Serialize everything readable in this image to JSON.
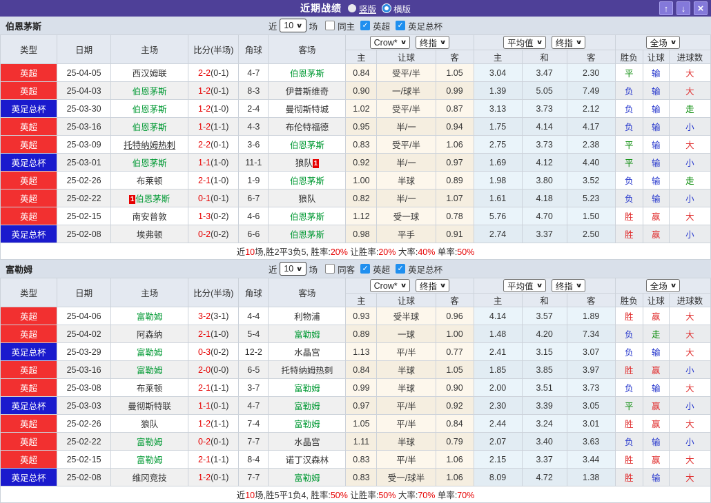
{
  "titlebar": {
    "title": "近期战绩",
    "radios": [
      {
        "label": "竖版",
        "selected": true
      },
      {
        "label": "横版",
        "selected": false
      }
    ],
    "up_icon": "↑",
    "down_icon": "↓",
    "close_icon": "×"
  },
  "colors": {
    "titlebar_purple": "#4e4098",
    "button_purple": "#8479da",
    "league_badge_red": "#f23030",
    "cup_badge_blue": "#1a1acd",
    "focus_team_green": "#009933",
    "score_red": "#e60000",
    "win_red": "#e03030",
    "loss_blue": "#2233cc",
    "draw_green": "#008800",
    "checkbox_blue": "#1f8fef"
  },
  "filter_labels": {
    "near": "近",
    "games": "场"
  },
  "table_header": {
    "left_cols": [
      "类型",
      "日期",
      "主场",
      "比分(半场)",
      "角球",
      "客场"
    ],
    "odds_selects": [
      "Crow*",
      "终指"
    ],
    "avg_selects": [
      "平均值",
      "终指"
    ],
    "scope_select": "全场",
    "sub_cols": [
      "主",
      "让球",
      "客",
      "主",
      "和",
      "客",
      "胜负",
      "让球",
      "进球数"
    ]
  },
  "sections": [
    {
      "team": "伯恩茅斯",
      "filter": {
        "count": "10",
        "same_label": "同主",
        "same_checked": false,
        "league_label": "英超",
        "league_checked": true,
        "cup_label": "英足总杯",
        "cup_checked": true
      },
      "rows": [
        {
          "type": "英超",
          "cup": false,
          "date": "25-04-05",
          "home": "西汉姆联",
          "hf": false,
          "hb": "",
          "hu": false,
          "score": "2-2",
          "half": "(0-1)",
          "corner": "4-7",
          "away": "伯恩茅斯",
          "af": true,
          "ab": "",
          "odds": [
            "0.84",
            "受平/半",
            "1.05"
          ],
          "avg": [
            "3.04",
            "3.47",
            "2.30"
          ],
          "res": [
            [
              "平",
              "g"
            ],
            [
              "输",
              "b"
            ],
            [
              "大",
              "r"
            ]
          ]
        },
        {
          "type": "英超",
          "cup": false,
          "date": "25-04-03",
          "home": "伯恩茅斯",
          "hf": true,
          "hb": "",
          "hu": false,
          "score": "1-2",
          "half": "(0-1)",
          "corner": "8-3",
          "away": "伊普斯维奇",
          "af": false,
          "ab": "",
          "odds": [
            "0.90",
            "一/球半",
            "0.99"
          ],
          "avg": [
            "1.39",
            "5.05",
            "7.49"
          ],
          "res": [
            [
              "负",
              "b"
            ],
            [
              "输",
              "b"
            ],
            [
              "大",
              "r"
            ]
          ]
        },
        {
          "type": "英足总杯",
          "cup": true,
          "date": "25-03-30",
          "home": "伯恩茅斯",
          "hf": true,
          "hb": "",
          "hu": false,
          "score": "1-2",
          "half": "(1-0)",
          "corner": "2-4",
          "away": "曼彻斯特城",
          "af": false,
          "ab": "",
          "odds": [
            "1.02",
            "受平/半",
            "0.87"
          ],
          "avg": [
            "3.13",
            "3.73",
            "2.12"
          ],
          "res": [
            [
              "负",
              "b"
            ],
            [
              "输",
              "b"
            ],
            [
              "走",
              "g"
            ]
          ]
        },
        {
          "type": "英超",
          "cup": false,
          "date": "25-03-16",
          "home": "伯恩茅斯",
          "hf": true,
          "hb": "",
          "hu": false,
          "score": "1-2",
          "half": "(1-1)",
          "corner": "4-3",
          "away": "布伦特福德",
          "af": false,
          "ab": "",
          "odds": [
            "0.95",
            "半/一",
            "0.94"
          ],
          "avg": [
            "1.75",
            "4.14",
            "4.17"
          ],
          "res": [
            [
              "负",
              "b"
            ],
            [
              "输",
              "b"
            ],
            [
              "小",
              "b"
            ]
          ]
        },
        {
          "type": "英超",
          "cup": false,
          "date": "25-03-09",
          "home": "托特纳姆热刺",
          "hf": false,
          "hb": "",
          "hu": true,
          "score": "2-2",
          "half": "(0-1)",
          "corner": "3-6",
          "away": "伯恩茅斯",
          "af": true,
          "ab": "",
          "odds": [
            "0.83",
            "受平/半",
            "1.06"
          ],
          "avg": [
            "2.75",
            "3.73",
            "2.38"
          ],
          "res": [
            [
              "平",
              "g"
            ],
            [
              "输",
              "b"
            ],
            [
              "大",
              "r"
            ]
          ]
        },
        {
          "type": "英足总杯",
          "cup": true,
          "date": "25-03-01",
          "home": "伯恩茅斯",
          "hf": true,
          "hb": "",
          "hu": false,
          "score": "1-1",
          "half": "(1-0)",
          "corner": "11-1",
          "away": "狼队",
          "af": false,
          "ab": "1",
          "odds": [
            "0.92",
            "半/一",
            "0.97"
          ],
          "avg": [
            "1.69",
            "4.12",
            "4.40"
          ],
          "res": [
            [
              "平",
              "g"
            ],
            [
              "输",
              "b"
            ],
            [
              "小",
              "b"
            ]
          ]
        },
        {
          "type": "英超",
          "cup": false,
          "date": "25-02-26",
          "home": "布莱顿",
          "hf": false,
          "hb": "",
          "hu": false,
          "score": "2-1",
          "half": "(1-0)",
          "corner": "1-9",
          "away": "伯恩茅斯",
          "af": true,
          "ab": "",
          "odds": [
            "1.00",
            "半球",
            "0.89"
          ],
          "avg": [
            "1.98",
            "3.80",
            "3.52"
          ],
          "res": [
            [
              "负",
              "b"
            ],
            [
              "输",
              "b"
            ],
            [
              "走",
              "g"
            ]
          ]
        },
        {
          "type": "英超",
          "cup": false,
          "date": "25-02-22",
          "home": "伯恩茅斯",
          "hf": true,
          "hb": "1",
          "hu": false,
          "score": "0-1",
          "half": "(0-1)",
          "corner": "6-7",
          "away": "狼队",
          "af": false,
          "ab": "",
          "odds": [
            "0.82",
            "半/一",
            "1.07"
          ],
          "avg": [
            "1.61",
            "4.18",
            "5.23"
          ],
          "res": [
            [
              "负",
              "b"
            ],
            [
              "输",
              "b"
            ],
            [
              "小",
              "b"
            ]
          ]
        },
        {
          "type": "英超",
          "cup": false,
          "date": "25-02-15",
          "home": "南安普敦",
          "hf": false,
          "hb": "",
          "hu": false,
          "score": "1-3",
          "half": "(0-2)",
          "corner": "4-6",
          "away": "伯恩茅斯",
          "af": true,
          "ab": "",
          "odds": [
            "1.12",
            "受一球",
            "0.78"
          ],
          "avg": [
            "5.76",
            "4.70",
            "1.50"
          ],
          "res": [
            [
              "胜",
              "r"
            ],
            [
              "赢",
              "r"
            ],
            [
              "大",
              "r"
            ]
          ]
        },
        {
          "type": "英足总杯",
          "cup": true,
          "date": "25-02-08",
          "home": "埃弗顿",
          "hf": false,
          "hb": "",
          "hu": false,
          "score": "0-2",
          "half": "(0-2)",
          "corner": "6-6",
          "away": "伯恩茅斯",
          "af": true,
          "ab": "",
          "odds": [
            "0.98",
            "平手",
            "0.91"
          ],
          "avg": [
            "2.74",
            "3.37",
            "2.50"
          ],
          "res": [
            [
              "胜",
              "r"
            ],
            [
              "赢",
              "r"
            ],
            [
              "小",
              "b"
            ]
          ]
        }
      ],
      "summary": [
        [
          "近",
          0
        ],
        [
          "10",
          1
        ],
        [
          "场,胜2平3负5, 胜率:",
          0
        ],
        [
          "20%",
          1
        ],
        [
          " 让胜率:",
          0
        ],
        [
          "20%",
          1
        ],
        [
          " 大率:",
          0
        ],
        [
          "40%",
          1
        ],
        [
          " 单率:",
          0
        ],
        [
          "50%",
          1
        ]
      ]
    },
    {
      "team": "富勒姆",
      "filter": {
        "count": "10",
        "same_label": "同客",
        "same_checked": false,
        "league_label": "英超",
        "league_checked": true,
        "cup_label": "英足总杯",
        "cup_checked": true
      },
      "rows": [
        {
          "type": "英超",
          "cup": false,
          "date": "25-04-06",
          "home": "富勒姆",
          "hf": true,
          "hb": "",
          "hu": false,
          "score": "3-2",
          "half": "(3-1)",
          "corner": "4-4",
          "away": "利物浦",
          "af": false,
          "ab": "",
          "odds": [
            "0.93",
            "受半球",
            "0.96"
          ],
          "avg": [
            "4.14",
            "3.57",
            "1.89"
          ],
          "res": [
            [
              "胜",
              "r"
            ],
            [
              "赢",
              "r"
            ],
            [
              "大",
              "r"
            ]
          ]
        },
        {
          "type": "英超",
          "cup": false,
          "date": "25-04-02",
          "home": "阿森纳",
          "hf": false,
          "hb": "",
          "hu": false,
          "score": "2-1",
          "half": "(1-0)",
          "corner": "5-4",
          "away": "富勒姆",
          "af": true,
          "ab": "",
          "odds": [
            "0.89",
            "一球",
            "1.00"
          ],
          "avg": [
            "1.48",
            "4.20",
            "7.34"
          ],
          "res": [
            [
              "负",
              "b"
            ],
            [
              "走",
              "g"
            ],
            [
              "大",
              "r"
            ]
          ]
        },
        {
          "type": "英足总杯",
          "cup": true,
          "date": "25-03-29",
          "home": "富勒姆",
          "hf": true,
          "hb": "",
          "hu": false,
          "score": "0-3",
          "half": "(0-2)",
          "corner": "12-2",
          "away": "水晶宫",
          "af": false,
          "ab": "",
          "odds": [
            "1.13",
            "平/半",
            "0.77"
          ],
          "avg": [
            "2.41",
            "3.15",
            "3.07"
          ],
          "res": [
            [
              "负",
              "b"
            ],
            [
              "输",
              "b"
            ],
            [
              "大",
              "r"
            ]
          ]
        },
        {
          "type": "英超",
          "cup": false,
          "date": "25-03-16",
          "home": "富勒姆",
          "hf": true,
          "hb": "",
          "hu": false,
          "score": "2-0",
          "half": "(0-0)",
          "corner": "6-5",
          "away": "托特纳姆热刺",
          "af": false,
          "ab": "",
          "odds": [
            "0.84",
            "半球",
            "1.05"
          ],
          "avg": [
            "1.85",
            "3.85",
            "3.97"
          ],
          "res": [
            [
              "胜",
              "r"
            ],
            [
              "赢",
              "r"
            ],
            [
              "小",
              "b"
            ]
          ]
        },
        {
          "type": "英超",
          "cup": false,
          "date": "25-03-08",
          "home": "布莱顿",
          "hf": false,
          "hb": "",
          "hu": false,
          "score": "2-1",
          "half": "(1-1)",
          "corner": "3-7",
          "away": "富勒姆",
          "af": true,
          "ab": "",
          "odds": [
            "0.99",
            "半球",
            "0.90"
          ],
          "avg": [
            "2.00",
            "3.51",
            "3.73"
          ],
          "res": [
            [
              "负",
              "b"
            ],
            [
              "输",
              "b"
            ],
            [
              "大",
              "r"
            ]
          ]
        },
        {
          "type": "英足总杯",
          "cup": true,
          "date": "25-03-03",
          "home": "曼彻斯特联",
          "hf": false,
          "hb": "",
          "hu": false,
          "score": "1-1",
          "half": "(0-1)",
          "corner": "4-7",
          "away": "富勒姆",
          "af": true,
          "ab": "",
          "odds": [
            "0.97",
            "平/半",
            "0.92"
          ],
          "avg": [
            "2.30",
            "3.39",
            "3.05"
          ],
          "res": [
            [
              "平",
              "g"
            ],
            [
              "赢",
              "r"
            ],
            [
              "小",
              "b"
            ]
          ]
        },
        {
          "type": "英超",
          "cup": false,
          "date": "25-02-26",
          "home": "狼队",
          "hf": false,
          "hb": "",
          "hu": false,
          "score": "1-2",
          "half": "(1-1)",
          "corner": "7-4",
          "away": "富勒姆",
          "af": true,
          "ab": "",
          "odds": [
            "1.05",
            "平/半",
            "0.84"
          ],
          "avg": [
            "2.44",
            "3.24",
            "3.01"
          ],
          "res": [
            [
              "胜",
              "r"
            ],
            [
              "赢",
              "r"
            ],
            [
              "大",
              "r"
            ]
          ]
        },
        {
          "type": "英超",
          "cup": false,
          "date": "25-02-22",
          "home": "富勒姆",
          "hf": true,
          "hb": "",
          "hu": false,
          "score": "0-2",
          "half": "(0-1)",
          "corner": "7-7",
          "away": "水晶宫",
          "af": false,
          "ab": "",
          "odds": [
            "1.11",
            "半球",
            "0.79"
          ],
          "avg": [
            "2.07",
            "3.40",
            "3.63"
          ],
          "res": [
            [
              "负",
              "b"
            ],
            [
              "输",
              "b"
            ],
            [
              "小",
              "b"
            ]
          ]
        },
        {
          "type": "英超",
          "cup": false,
          "date": "25-02-15",
          "home": "富勒姆",
          "hf": true,
          "hb": "",
          "hu": false,
          "score": "2-1",
          "half": "(1-1)",
          "corner": "8-4",
          "away": "诺丁汉森林",
          "af": false,
          "ab": "",
          "odds": [
            "0.83",
            "平/半",
            "1.06"
          ],
          "avg": [
            "2.15",
            "3.37",
            "3.44"
          ],
          "res": [
            [
              "胜",
              "r"
            ],
            [
              "赢",
              "r"
            ],
            [
              "大",
              "r"
            ]
          ]
        },
        {
          "type": "英足总杯",
          "cup": true,
          "date": "25-02-08",
          "home": "维冈竞技",
          "hf": false,
          "hb": "",
          "hu": false,
          "score": "1-2",
          "half": "(0-1)",
          "corner": "7-7",
          "away": "富勒姆",
          "af": true,
          "ab": "",
          "odds": [
            "0.83",
            "受一/球半",
            "1.06"
          ],
          "avg": [
            "8.09",
            "4.72",
            "1.38"
          ],
          "res": [
            [
              "胜",
              "r"
            ],
            [
              "输",
              "b"
            ],
            [
              "大",
              "r"
            ]
          ]
        }
      ],
      "summary": [
        [
          "近",
          0
        ],
        [
          "10",
          1
        ],
        [
          "场,胜5平1负4, 胜率:",
          0
        ],
        [
          "50%",
          1
        ],
        [
          " 让胜率:",
          0
        ],
        [
          "50%",
          1
        ],
        [
          " 大率:",
          0
        ],
        [
          "70%",
          1
        ],
        [
          " 单率:",
          0
        ],
        [
          "70%",
          1
        ]
      ]
    }
  ]
}
